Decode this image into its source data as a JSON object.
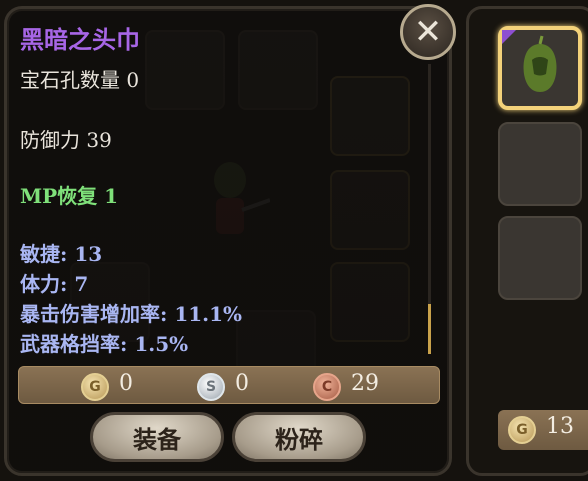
{
  "tooltip": {
    "item_name": "黑暗之头巾",
    "socket_count": "宝石孔数量 0",
    "defense": "防御力 39",
    "mp_regen": "MP恢复 1",
    "stats": [
      "敏捷: 13",
      "体力: 7",
      "暴击伤害增加率: 11.1%",
      "武器格挡率: 1.5%"
    ],
    "name_color": "#a766e6",
    "mp_color": "#7fe07a",
    "stat_color": "#a9b6f2"
  },
  "currency": {
    "gold_icon": "G",
    "gold": "0",
    "silver_icon": "S",
    "silver": "0",
    "copper_icon": "C",
    "copper": "29"
  },
  "buttons": {
    "equip": "装备",
    "dismantle": "粉碎"
  },
  "side_panel": {
    "gold_icon": "G",
    "gold": "13"
  },
  "icons": {
    "close": "close-icon",
    "helmet": "hood-icon"
  }
}
